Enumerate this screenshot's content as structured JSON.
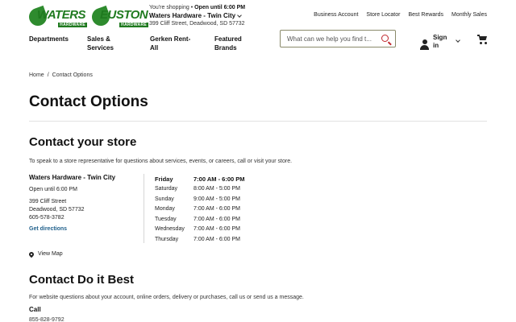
{
  "header": {
    "logos": {
      "waters": {
        "word": "WATERS",
        "sub": "HARDWARE"
      },
      "euston": {
        "word": "EUSTON",
        "sub": "HARDWARE"
      }
    },
    "store": {
      "shopping_label": "You're shopping",
      "separator": "•",
      "open_label": "Open until 6:00 PM",
      "name": "Waters Hardware - Twin City",
      "address": "399 Cliff Street, Deadwood, SD 57732"
    },
    "util_links": [
      "Business Account",
      "Store Locator",
      "Best Rewards",
      "Monthly Sales"
    ],
    "nav": {
      "departments": "Departments",
      "sales_line1": "Sales &",
      "sales_line2": "Services",
      "gerken_line1": "Gerken Rent-",
      "gerken_line2": "All",
      "brands_line1": "Featured",
      "brands_line2": "Brands"
    },
    "search": {
      "placeholder": "What can we help you find t..."
    },
    "signin": {
      "line1": "Sign",
      "line2": "in"
    }
  },
  "breadcrumb": {
    "home": "Home",
    "separator": "/",
    "current": "Contact Options"
  },
  "page_title": "Contact Options",
  "store_section": {
    "heading": "Contact your store",
    "intro": "To speak to a store representative for questions about services, events, or careers, call or visit your store.",
    "store_name": "Waters Hardware - Twin City",
    "open_status": "Open until 6:00 PM",
    "street": "399 Cliff Street",
    "city": "Deadwood, SD 57732",
    "phone": "605-578-3782",
    "directions": "Get directions",
    "hours": [
      {
        "day": "Friday",
        "time": "7:00 AM - 6:00 PM"
      },
      {
        "day": "Saturday",
        "time": "8:00 AM - 5:00 PM"
      },
      {
        "day": "Sunday",
        "time": "9:00 AM - 5:00 PM"
      },
      {
        "day": "Monday",
        "time": "7:00 AM - 6:00 PM"
      },
      {
        "day": "Tuesday",
        "time": "7:00 AM - 6:00 PM"
      },
      {
        "day": "Wednesday",
        "time": "7:00 AM - 6:00 PM"
      },
      {
        "day": "Thursday",
        "time": "7:00 AM - 6:00 PM"
      }
    ],
    "view_map": "View Map"
  },
  "dib_section": {
    "heading": "Contact Do it Best",
    "intro": "For website questions about your account, online orders, delivery or purchases, call us or send us a message.",
    "call_label": "Call",
    "phone": "855-828-9792"
  },
  "colors": {
    "brand_green": "#1f7a1f",
    "accent_red": "#c0272d",
    "link_blue": "#1f5f8b"
  }
}
